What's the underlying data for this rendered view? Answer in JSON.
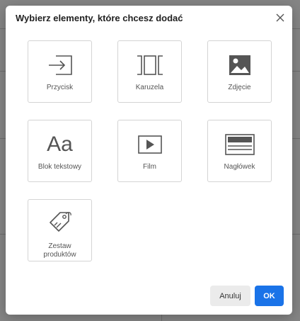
{
  "dialog": {
    "title": "Wybierz elementy, które chcesz dodać",
    "close_icon": "close-icon"
  },
  "elements": [
    {
      "label": "Przycisk",
      "icon": "button-enter-icon"
    },
    {
      "label": "Karuzela",
      "icon": "carousel-icon"
    },
    {
      "label": "Zdjęcie",
      "icon": "image-icon"
    },
    {
      "label": "Blok tekstowy",
      "icon": "text-aa-icon"
    },
    {
      "label": "Film",
      "icon": "video-play-icon"
    },
    {
      "label": "Nagłówek",
      "icon": "header-icon"
    },
    {
      "label": "Zestaw produktów",
      "label_line1": "Zestaw",
      "label_line2": "produktów",
      "icon": "product-tag-icon"
    }
  ],
  "footer": {
    "cancel_label": "Anuluj",
    "ok_label": "OK"
  },
  "colors": {
    "primary": "#1a73e8",
    "icon": "#555555",
    "border": "#d4d4d4"
  }
}
